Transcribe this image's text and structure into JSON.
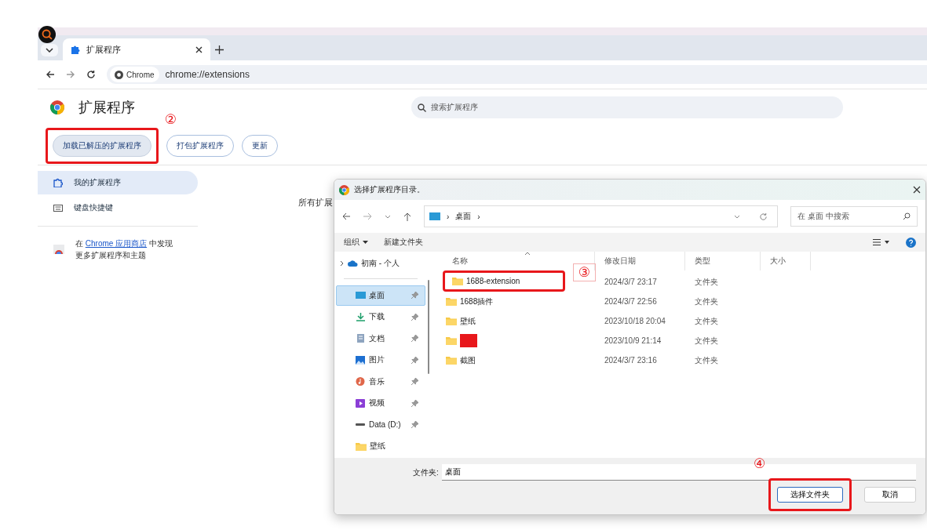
{
  "browser": {
    "tab": {
      "title": "扩展程序",
      "selected": true
    },
    "address": {
      "chip": "Chrome",
      "url": "chrome://extensions"
    }
  },
  "page": {
    "title": "扩展程序",
    "search": {
      "placeholder": "搜索扩展程序"
    },
    "buttons": [
      {
        "label": "加载已解压的扩展程序",
        "kind": "filled",
        "highlighted": true,
        "step": {
          "label": "②",
          "boxed": false
        }
      },
      {
        "label": "打包扩展程序",
        "kind": "outline",
        "highlighted": false
      },
      {
        "label": "更新",
        "kind": "outline",
        "highlighted": false
      }
    ],
    "sidebar": {
      "items": [
        {
          "label": "我的扩展程序",
          "selected": true
        },
        {
          "label": "键盘快捷键",
          "selected": false
        }
      ],
      "store": {
        "prefix": "在",
        "link": "Chrome 应用商店",
        "suffix": "中发现",
        "line2": "更多扩展程序和主题"
      }
    },
    "content_text": "所有扩展"
  },
  "dialog": {
    "title": "选择扩展程序目录。",
    "crumb_separators": [
      "›",
      "›"
    ],
    "breadcrumb": "桌面",
    "search": {
      "placeholder": "在 桌面 中搜索"
    },
    "toolbar": [
      "组织",
      "新建文件夹"
    ],
    "nav": [
      {
        "label": "初南 - 个人",
        "selected": false,
        "pinned": false
      },
      {
        "label": "桌面",
        "selected": true,
        "pinned": true
      },
      {
        "label": "下载",
        "selected": false,
        "pinned": true
      },
      {
        "label": "文档",
        "selected": false,
        "pinned": true
      },
      {
        "label": "图片",
        "selected": false,
        "pinned": true
      },
      {
        "label": "音乐",
        "selected": false,
        "pinned": true
      },
      {
        "label": "视频",
        "selected": false,
        "pinned": true
      },
      {
        "label": "Data (D:)",
        "selected": false,
        "pinned": true
      },
      {
        "label": "壁纸",
        "selected": false,
        "pinned": false
      }
    ],
    "columns": [
      "名称",
      "修改日期",
      "类型",
      "大小"
    ],
    "rows": [
      {
        "name": "1688-extension",
        "date": "2024/3/7 23:17",
        "type": "文件夹",
        "redacted": false,
        "highlighted": true,
        "step": {
          "label": "③",
          "boxed": true
        }
      },
      {
        "name": "1688插件",
        "date": "2024/3/7 22:56",
        "type": "文件夹",
        "redacted": false,
        "highlighted": false
      },
      {
        "name": "壁纸",
        "date": "2023/10/18 20:04",
        "type": "文件夹",
        "redacted": false,
        "highlighted": false
      },
      {
        "date": "2023/10/9 21:14",
        "type": "文件夹",
        "redacted": true,
        "highlighted": false
      },
      {
        "name": "截图",
        "date": "2024/3/7 23:16",
        "type": "文件夹",
        "redacted": false,
        "highlighted": false
      }
    ],
    "folder_label": "文件夹:",
    "folder_value": "桌面",
    "buttons": [
      {
        "label": "选择文件夹",
        "kind": "primary",
        "highlighted": true,
        "step": {
          "label": "④",
          "boxed": false
        }
      },
      {
        "label": "取消",
        "kind": "normal",
        "highlighted": false
      }
    ]
  }
}
